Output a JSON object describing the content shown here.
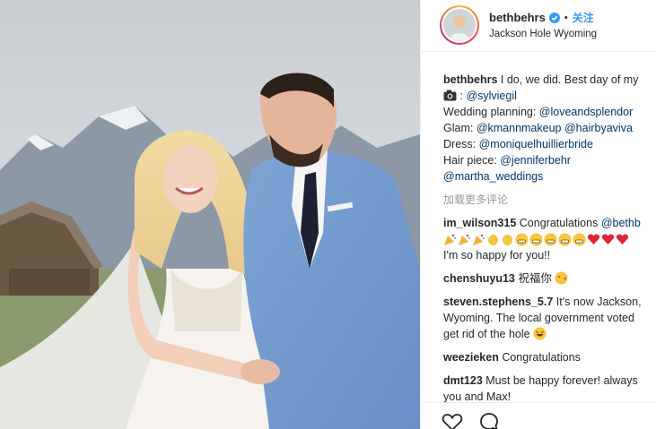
{
  "post": {
    "username": "bethbehrs",
    "follow_label": "关注",
    "separator": "•",
    "location": "Jackson Hole Wyoming",
    "caption": {
      "first_line_text": " I do, we did. Best day of my",
      "photographer": "@sylviegil",
      "planning_label": "Wedding planning: ",
      "planning_mention": "@loveandsplendor",
      "glam_label": "Glam: ",
      "glam_mention_1": "@kmannmakeup",
      "glam_mention_2": "@hairbyaviva",
      "dress_label": "Dress: ",
      "dress_mention": "@moniquelhuillierbride",
      "hair_label": "Hair piece: ",
      "hair_mention": "@jenniferbehr",
      "final_mention": "@martha_weddings"
    },
    "load_more": "加载更多评论"
  },
  "comments": [
    {
      "user": "im_wilson315",
      "text_1": " Congratulations ",
      "mention": "@bethb",
      "text_2": "I'm so happy for you!!"
    },
    {
      "user": "chenshuyu13",
      "text_1": " 祝福你"
    },
    {
      "user": "steven.stephens_5.7",
      "text_1": " It's now Jackson,",
      "text_2": "Wyoming. The local government voted",
      "text_3": "get rid of the hole"
    },
    {
      "user": "weezieken",
      "text_1": " Congratulations"
    },
    {
      "user": "dmt123",
      "text_1": " Must be happy forever! always",
      "text_2": "you and Max!"
    }
  ],
  "icons": {
    "verified": "verified-badge-icon",
    "like": "heart-icon",
    "comment": "comment-bubble-icon",
    "camera": "camera-icon"
  },
  "colors": {
    "follow": "#3897f0",
    "mention": "#003569",
    "muted": "#999999",
    "verified": "#3897f0"
  }
}
